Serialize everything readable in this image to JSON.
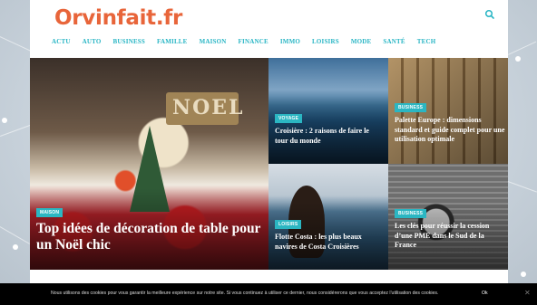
{
  "site": {
    "logo": "Orvinfait.fr",
    "accent_color": "#27b5c4",
    "logo_color": "#e8653a"
  },
  "nav": {
    "items": [
      "ACTU",
      "AUTO",
      "BUSINESS",
      "FAMILLE",
      "MAISON",
      "FINANCE",
      "IMMO",
      "LOISIRS",
      "MODE",
      "SANTÉ",
      "TECH"
    ]
  },
  "header": {
    "search_icon": "search-icon"
  },
  "featured": {
    "main": {
      "category": "MAISON",
      "title": "Top idées de décoration de table pour un Noël chic"
    },
    "croisiere": {
      "category": "VOYAGE",
      "title": "Croisière : 2 raisons de faire le tour du monde"
    },
    "palette": {
      "category": "BUSINESS",
      "title": "Palette Europe : dimensions standard et guide complet pour une utilisation optimale"
    },
    "flotte": {
      "category": "LOISIRS",
      "title": "Flotte Costa : les plus beaux navires de Costa Croisières"
    },
    "sud": {
      "category": "BUSINESS",
      "title": "Les clés pour réussir la cession d’une PME dans le Sud de la France"
    }
  },
  "cookie": {
    "text": "Nous utilisons des cookies pour vous garantir la meilleure expérience sur notre site. Si vous continuez à utiliser ce dernier, nous considérerons que vous acceptez l'utilisation des cookies.",
    "ok_label": "Ok",
    "close_icon": "close-icon"
  }
}
